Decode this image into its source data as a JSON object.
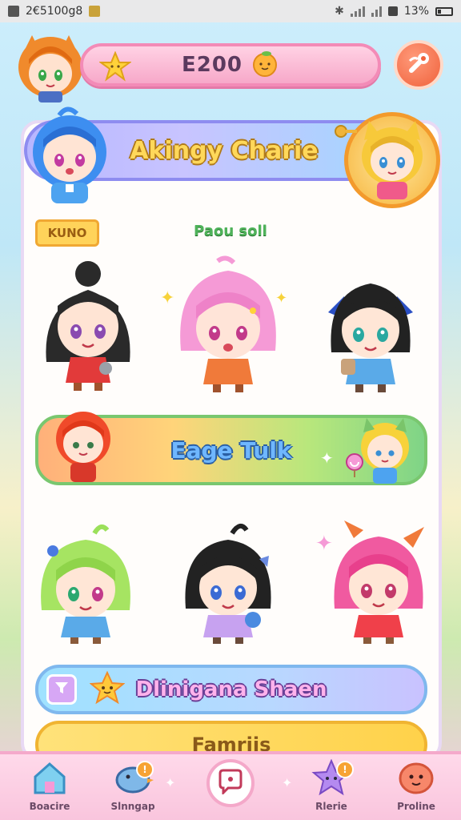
{
  "status_bar": {
    "time": "2€5100g8",
    "battery": "13%"
  },
  "top_bar": {
    "coins": "E200"
  },
  "main": {
    "title": "Akingy Charie",
    "tag": "KUNO",
    "section_label": "Paou soll",
    "banners": [
      {
        "label": "Eage Tulk"
      },
      {
        "label": "Dlinigana Shaen"
      },
      {
        "label": "Famriis"
      }
    ]
  },
  "bottom_nav": {
    "items": [
      {
        "label": "Boacire",
        "badge": ""
      },
      {
        "label": "Slnngap",
        "badge": "!"
      },
      {
        "label": "",
        "badge": ""
      },
      {
        "label": "Rlerie",
        "badge": "!"
      },
      {
        "label": "Proline",
        "badge": ""
      }
    ]
  },
  "colors": {
    "accent_pink": "#f38bb7",
    "accent_orange": "#f0623c",
    "title_gold": "#ffd85a",
    "label_green": "#4fb35a"
  },
  "icons": [
    "star-icon",
    "orange-fruit-icon",
    "settings-wrench-icon",
    "filter-icon",
    "home-icon",
    "bird-icon",
    "chat-bubble-icon",
    "star-character-icon",
    "face-icon"
  ]
}
